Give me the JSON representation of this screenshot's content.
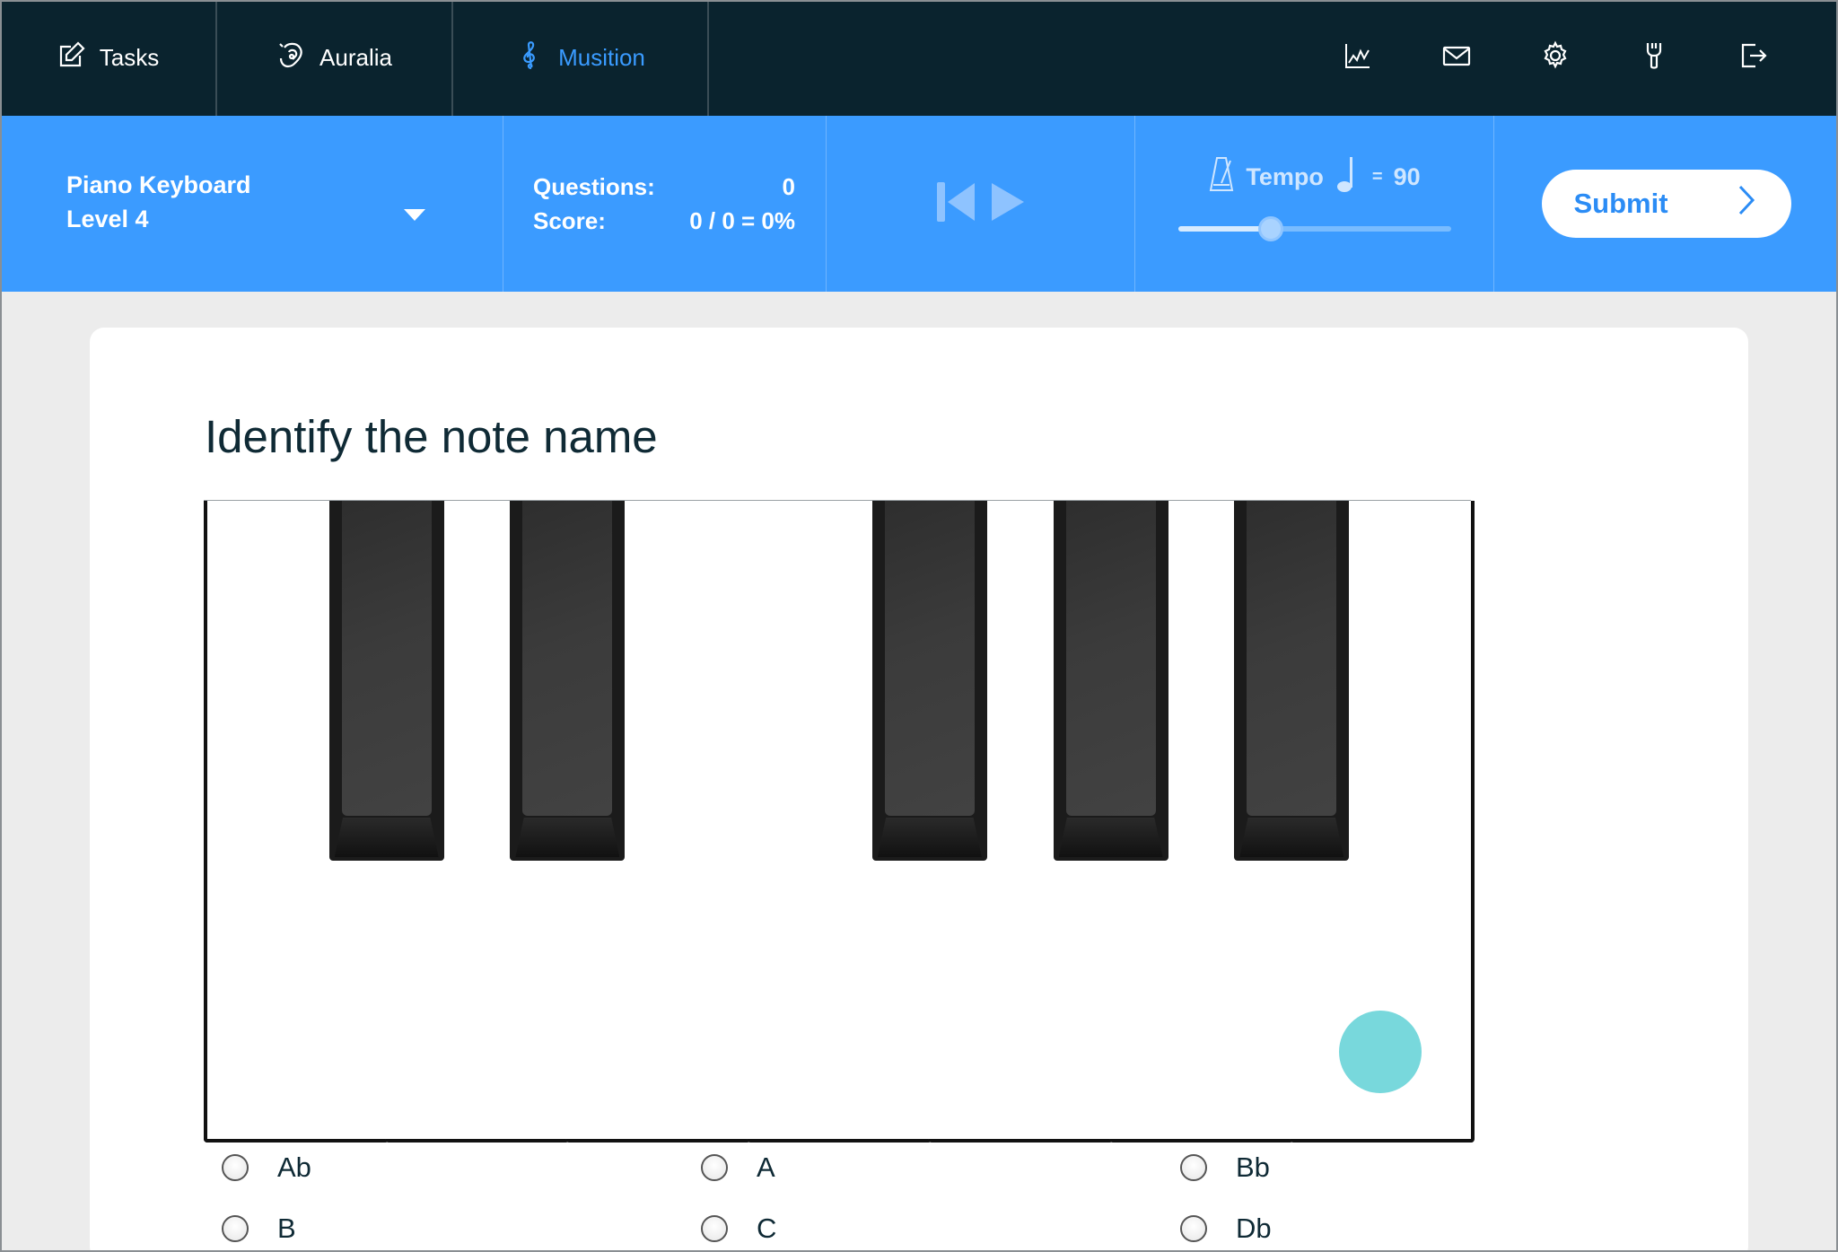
{
  "nav": {
    "tabs": [
      {
        "label": "Tasks",
        "icon": "edit-icon"
      },
      {
        "label": "Auralia",
        "icon": "ear-icon"
      },
      {
        "label": "Musition",
        "icon": "treble-clef-icon",
        "active": true
      }
    ],
    "icons": [
      "chart-icon",
      "mail-icon",
      "settings-icon",
      "tools-icon",
      "logout-icon"
    ]
  },
  "toolbar": {
    "exercise": "Piano Keyboard",
    "level": "Level 4",
    "questions_label": "Questions:",
    "questions_value": "0",
    "score_label": "Score:",
    "score_value": "0 / 0 = 0%",
    "tempo_label": "Tempo",
    "tempo_equals": "=",
    "tempo_value": "90",
    "tempo_fraction": 0.34,
    "submit_label": "Submit"
  },
  "question": {
    "title": "Identify the note name",
    "white_keys": 7,
    "black_keys_after_white": [
      0,
      1,
      3,
      4,
      5
    ],
    "marked_white_key": 6
  },
  "answers": [
    {
      "label": "Ab"
    },
    {
      "label": "A"
    },
    {
      "label": "Bb"
    },
    {
      "label": "B"
    },
    {
      "label": "C"
    },
    {
      "label": "Db"
    }
  ],
  "colors": {
    "nav_bg": "#0a232e",
    "toolbar_bg": "#3b9bff",
    "active_tab": "#3a9bff",
    "marker": "#78d8dc"
  }
}
